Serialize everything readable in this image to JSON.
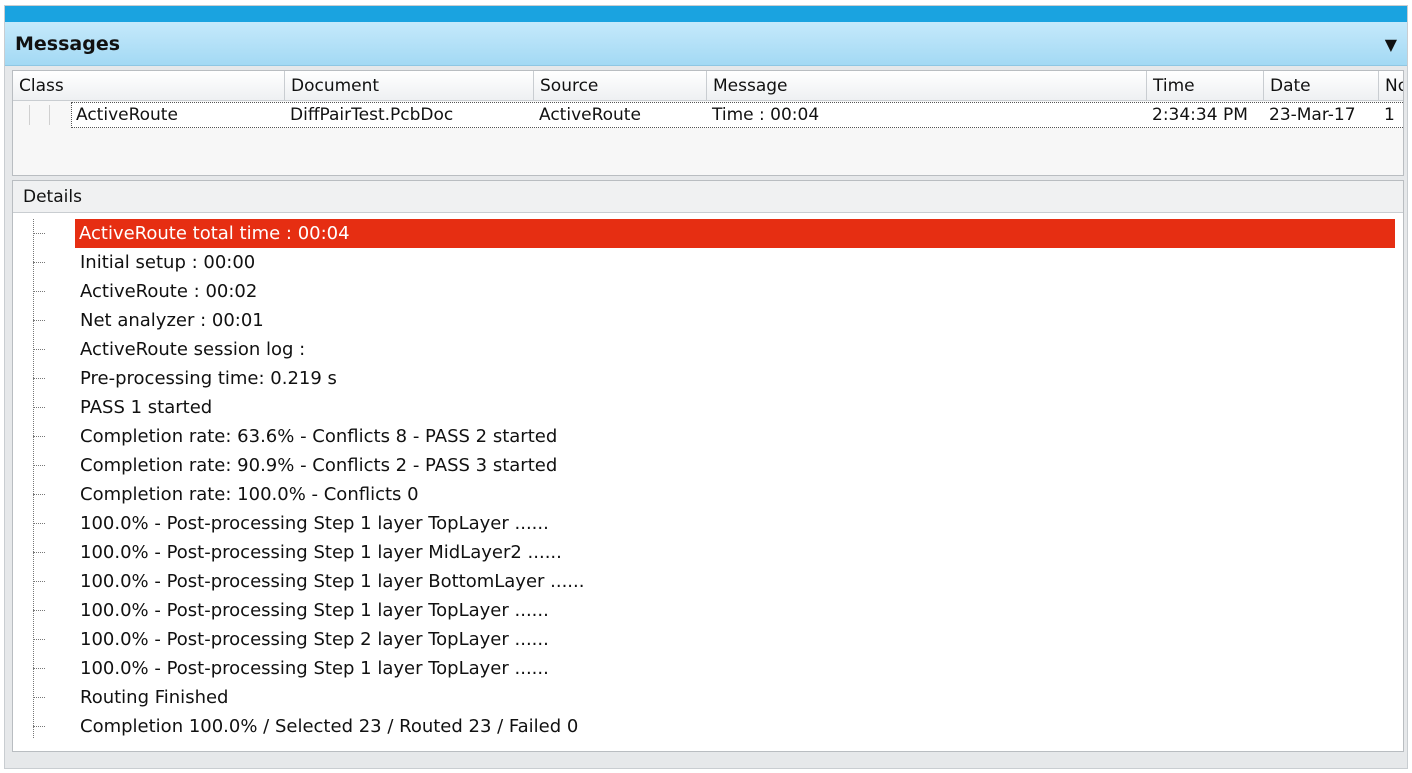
{
  "panel": {
    "title": "Messages",
    "menu_icon": "dropdown-arrow-icon"
  },
  "messages": {
    "columns": [
      "Class",
      "Document",
      "Source",
      "Message",
      "Time",
      "Date",
      "No"
    ],
    "rows": [
      {
        "class": "ActiveRoute",
        "document": "DiffPairTest.PcbDoc",
        "source": "ActiveRoute",
        "message": "Time : 00:04",
        "time": "2:34:34 PM",
        "date": "23-Mar-17",
        "no": "1"
      }
    ]
  },
  "details": {
    "title": "Details",
    "selected_color": "#e62e12",
    "items": [
      "ActiveRoute total time : 00:04",
      "Initial setup : 00:00",
      "ActiveRoute : 00:02",
      "Net analyzer : 00:01",
      "ActiveRoute session log :",
      "Pre-processing time: 0.219 s",
      "PASS 1 started",
      "Completion rate: 63.6% - Conflicts 8 - PASS 2 started",
      "Completion rate: 90.9% - Conflicts 2 - PASS 3 started",
      "Completion rate: 100.0% - Conflicts 0",
      "100.0% - Post-processing Step 1 layer TopLayer ......",
      "100.0% - Post-processing Step 1 layer MidLayer2 ......",
      "100.0% - Post-processing Step 1 layer BottomLayer ......",
      "100.0% - Post-processing Step 1 layer TopLayer ......",
      "100.0% - Post-processing Step 2 layer TopLayer ......",
      "100.0% - Post-processing Step 1 layer TopLayer ......",
      "Routing Finished",
      "Completion 100.0% / Selected 23 / Routed 23 / Failed 0"
    ]
  }
}
